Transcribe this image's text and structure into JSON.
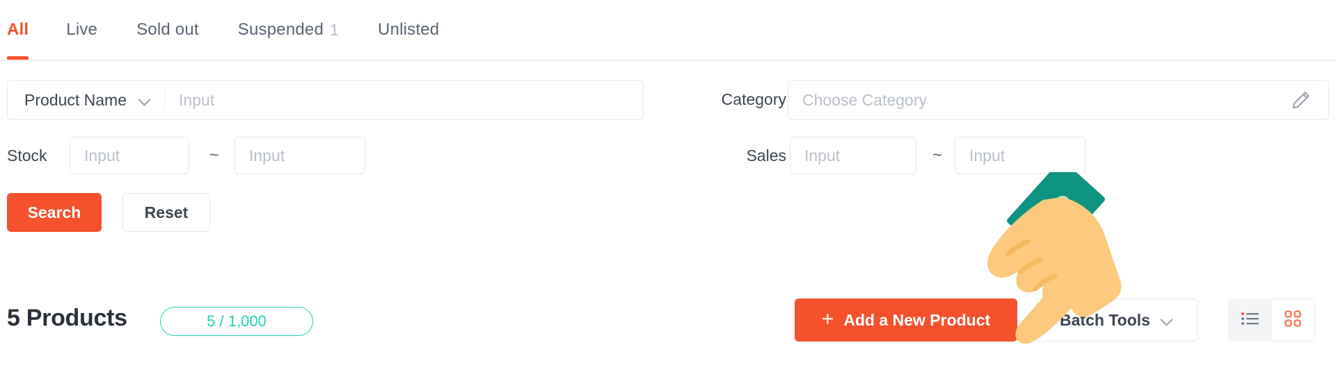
{
  "tabs": [
    {
      "label": "All",
      "count": "",
      "active": true
    },
    {
      "label": "Live",
      "count": "",
      "active": false
    },
    {
      "label": "Sold out",
      "count": "",
      "active": false
    },
    {
      "label": "Suspended",
      "count": "1",
      "active": false
    },
    {
      "label": "Unlisted",
      "count": "",
      "active": false
    }
  ],
  "filters": {
    "field_select": {
      "value": "Product Name",
      "icon": "chevron-down-icon"
    },
    "keyword_input": {
      "value": "",
      "placeholder": "Input"
    },
    "category": {
      "label": "Category",
      "value": "",
      "placeholder": "Choose Category",
      "icon": "pencil-icon"
    },
    "stock": {
      "label": "Stock",
      "min": {
        "value": "",
        "placeholder": "Input"
      },
      "max": {
        "value": "",
        "placeholder": "Input"
      },
      "separator": "~"
    },
    "sales": {
      "label": "Sales",
      "min": {
        "value": "",
        "placeholder": "Input"
      },
      "max": {
        "value": "",
        "placeholder": "Input"
      },
      "separator": "~"
    },
    "search_button": "Search",
    "reset_button": "Reset"
  },
  "list_header": {
    "count_title": "5 Products",
    "quota": "5 / 1,000",
    "add_button": {
      "label": "Add a New Product",
      "icon": "plus-icon"
    },
    "batch_button": {
      "label": "Batch Tools",
      "icon": "chevron-down-icon"
    },
    "view_toggle": {
      "list_icon": "list-view-icon",
      "grid_icon": "grid-view-icon",
      "active": "grid"
    }
  },
  "colors": {
    "accent": "#f4512c",
    "teal": "#1fd2b6",
    "cursor_sleeve": "#0d9480",
    "cursor_skin": "#fcc97e",
    "text": "#3d4551",
    "muted": "#b9bfc7",
    "border": "#e3e6ea"
  },
  "cursor": {
    "type": "pointing-hand-cursor"
  }
}
